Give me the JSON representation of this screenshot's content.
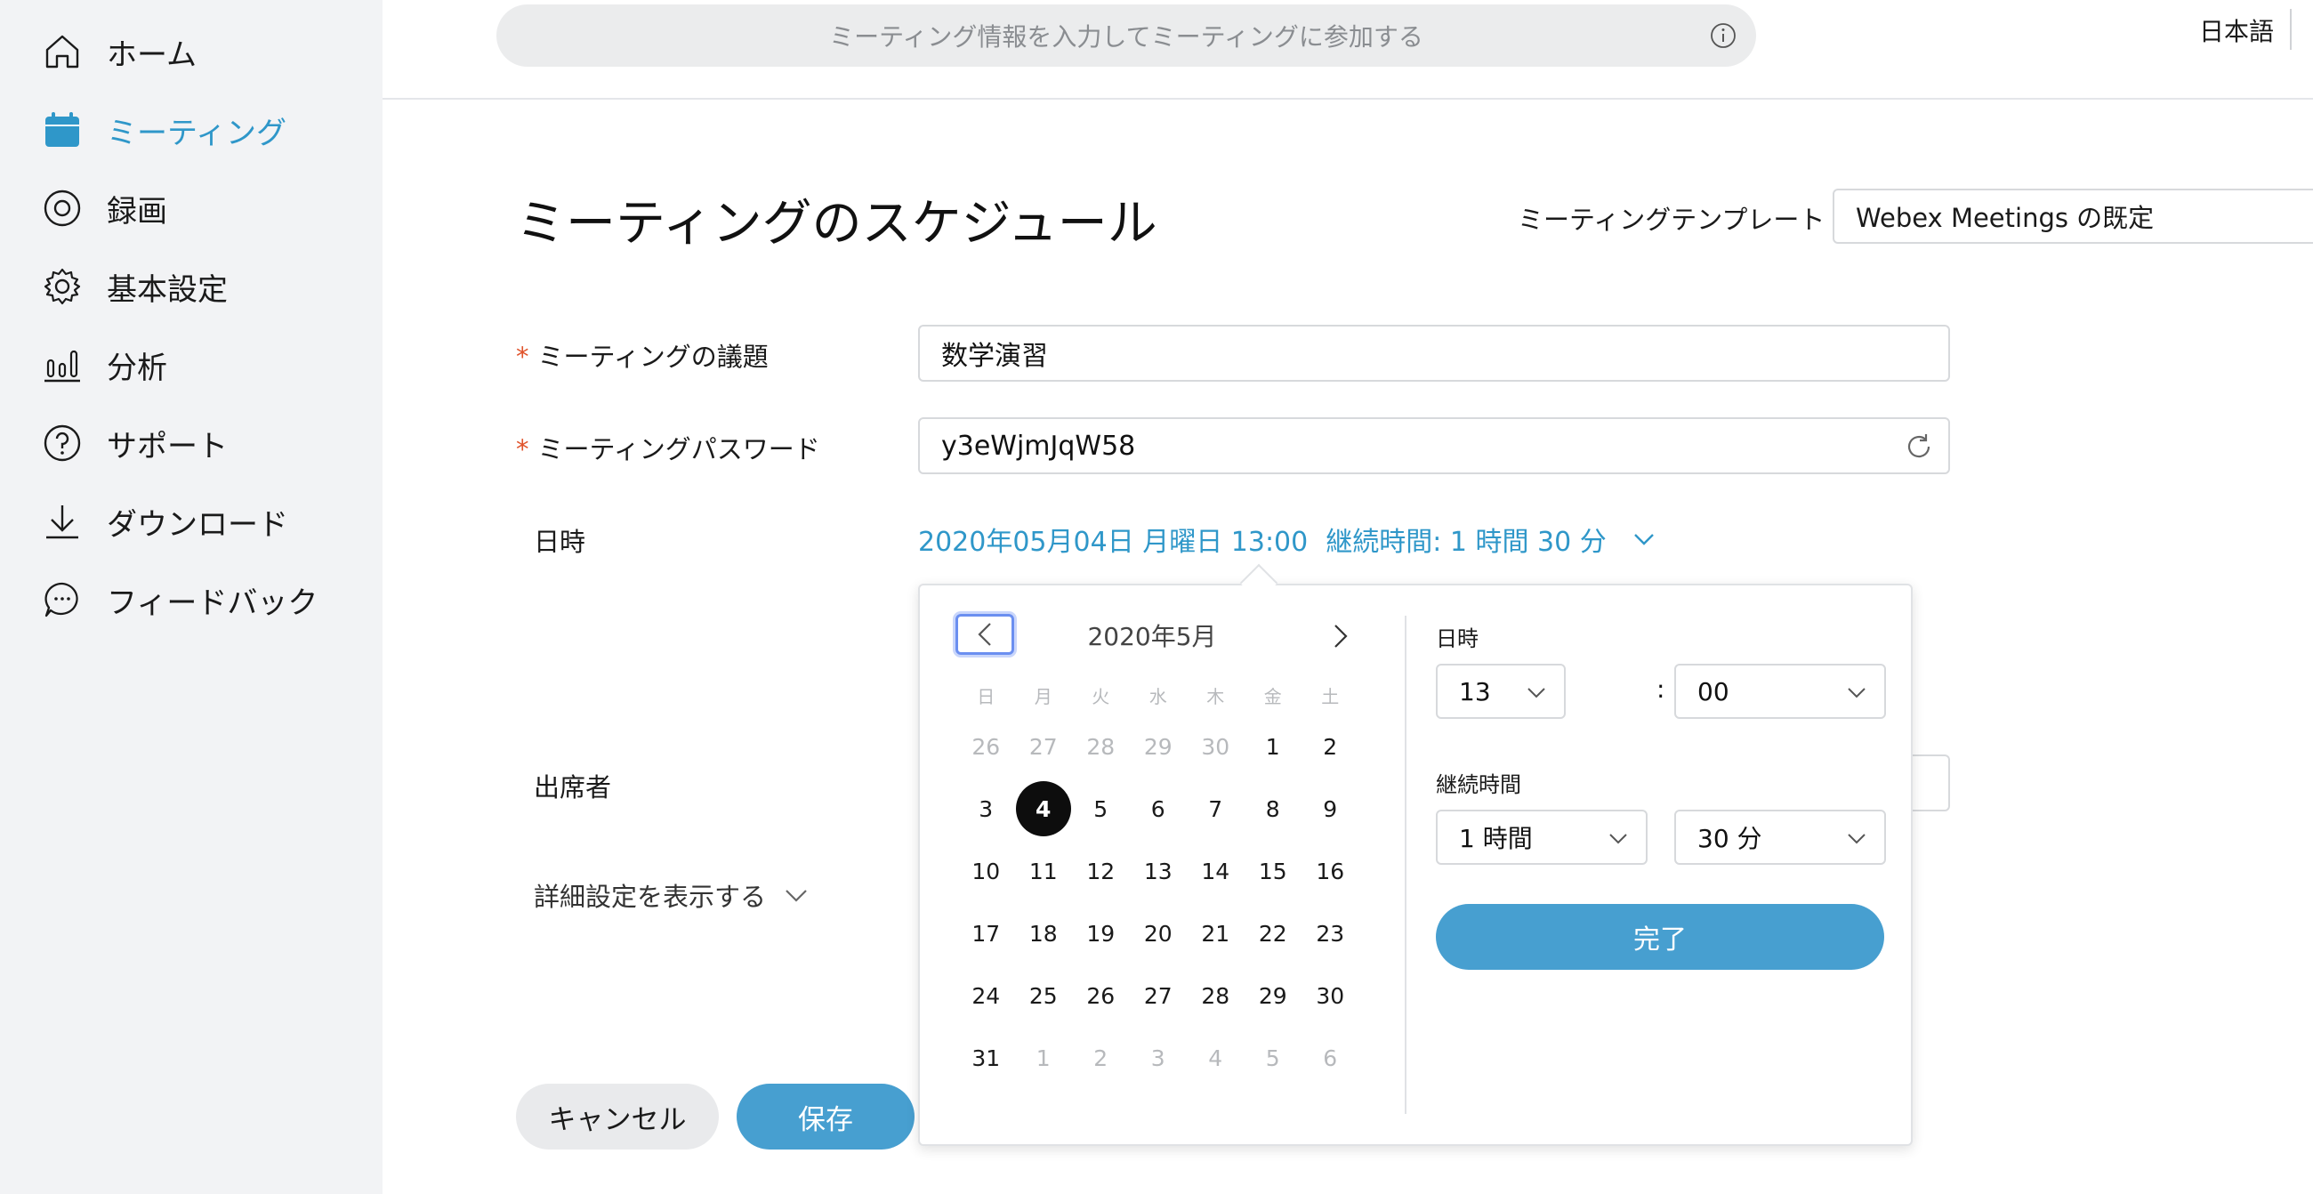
{
  "sidebar": {
    "items": [
      {
        "label": "ホーム",
        "icon": "home-icon"
      },
      {
        "label": "ミーティング",
        "icon": "calendar-icon",
        "active": true
      },
      {
        "label": "録画",
        "icon": "recording-icon"
      },
      {
        "label": "基本設定",
        "icon": "gear-icon"
      },
      {
        "label": "分析",
        "icon": "bar-chart-icon"
      },
      {
        "label": "サポート",
        "icon": "help-icon"
      },
      {
        "label": "ダウンロード",
        "icon": "download-icon"
      },
      {
        "label": "フィードバック",
        "icon": "feedback-icon"
      }
    ]
  },
  "header": {
    "join_placeholder": "ミーティング情報を入力してミーティングに参加する",
    "language": "日本語"
  },
  "page": {
    "title": "ミーティングのスケジュール",
    "template_label": "ミーティングテンプレート",
    "template_value": "Webex Meetings の既定"
  },
  "form": {
    "topic_label": "ミーティングの議題",
    "topic_value": "数学演習",
    "password_label": "ミーティングパスワード",
    "password_value": "y3eWjmJqW58",
    "datetime_label": "日時",
    "datetime_value": "2020年05月04日 月曜日 13:00",
    "duration_text": "継続時間:  1 時間 30 分",
    "attendees_label": "出席者",
    "advanced_label": "詳細設定を表示する",
    "required_mark": "*"
  },
  "buttons": {
    "cancel": "キャンセル",
    "save": "保存"
  },
  "datepicker": {
    "month_title": "2020年5月",
    "weekdays": [
      "日",
      "月",
      "火",
      "水",
      "木",
      "金",
      "土"
    ],
    "weeks": [
      [
        {
          "d": "26",
          "m": true
        },
        {
          "d": "27",
          "m": true
        },
        {
          "d": "28",
          "m": true
        },
        {
          "d": "29",
          "m": true
        },
        {
          "d": "30",
          "m": true
        },
        {
          "d": "1"
        },
        {
          "d": "2"
        }
      ],
      [
        {
          "d": "3"
        },
        {
          "d": "4",
          "sel": true
        },
        {
          "d": "5"
        },
        {
          "d": "6"
        },
        {
          "d": "7"
        },
        {
          "d": "8"
        },
        {
          "d": "9"
        }
      ],
      [
        {
          "d": "10"
        },
        {
          "d": "11"
        },
        {
          "d": "12"
        },
        {
          "d": "13"
        },
        {
          "d": "14"
        },
        {
          "d": "15"
        },
        {
          "d": "16"
        }
      ],
      [
        {
          "d": "17"
        },
        {
          "d": "18"
        },
        {
          "d": "19"
        },
        {
          "d": "20"
        },
        {
          "d": "21"
        },
        {
          "d": "22"
        },
        {
          "d": "23"
        }
      ],
      [
        {
          "d": "24"
        },
        {
          "d": "25"
        },
        {
          "d": "26"
        },
        {
          "d": "27"
        },
        {
          "d": "28"
        },
        {
          "d": "29"
        },
        {
          "d": "30"
        }
      ],
      [
        {
          "d": "31"
        },
        {
          "d": "1",
          "m": true
        },
        {
          "d": "2",
          "m": true
        },
        {
          "d": "3",
          "m": true
        },
        {
          "d": "4",
          "m": true
        },
        {
          "d": "5",
          "m": true
        },
        {
          "d": "6",
          "m": true
        }
      ]
    ],
    "time_label": "日時",
    "hour_value": "13",
    "minute_value": "00",
    "time_separator": ":",
    "duration_label": "継続時間",
    "duration_hours_value": "1 時間",
    "duration_minutes_value": "30 分",
    "done_label": "完了"
  },
  "colors": {
    "accent": "#2f97c9",
    "button_primary": "#479fd0",
    "sidebar_bg": "#f2f3f5",
    "required": "#e0532b"
  }
}
